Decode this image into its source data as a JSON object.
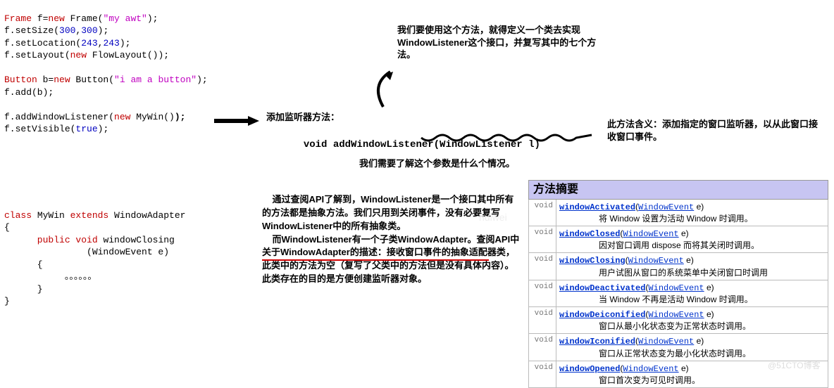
{
  "code": {
    "l1_a": "Frame",
    "l1_b": " f=",
    "l1_c": "new",
    "l1_d": " Frame(",
    "l1_e": "\"my awt\"",
    "l1_f": ");",
    "l2_a": "f.setSize(",
    "l2_b": "300",
    "l2_c": ",",
    "l2_d": "300",
    "l2_e": ");",
    "l3_a": "f.setLocation(",
    "l3_b": "243",
    "l3_c": ",",
    "l3_d": "243",
    "l3_e": ");",
    "l4_a": "f.setLayout(",
    "l4_b": "new",
    "l4_c": " FlowLayout());",
    "l5_a": "Button",
    "l5_b": " b=",
    "l5_c": "new",
    "l5_d": " Button(",
    "l5_e": "\"i am a button\"",
    "l5_f": ");",
    "l6": "f.add(b);",
    "l7_a": "f.addWindowListener(",
    "l7_b": "new",
    "l7_c": " MyWin()",
    "l7_d": ");",
    "l8_a": "f.setVisible(",
    "l8_b": "true",
    "l8_c": ");"
  },
  "code2": {
    "l1_a": "class",
    "l1_b": " MyWin ",
    "l1_c": "extends",
    "l1_d": " WindowAdapter",
    "l2": "{",
    "l3_a": "      public",
    "l3_b": " void",
    "l3_c": " windowClosing",
    "l4": "               (WindowEvent e)",
    "l5": "      {",
    "l6": "           。。。。。。",
    "l7": "      }",
    "l8": "}"
  },
  "notes": {
    "top": "我们要使用这个方法，就得定义一个类去实现WindowListener这个接口，并复写其中的七个方法。",
    "add": "添加监听器方法：",
    "sig_a": "void addWindowListener(",
    "sig_b": "WindowListener l",
    "sig_c": ")",
    "right": "此方法含义：添加指定的窗口监听器，以从此窗口接收窗口事件。",
    "param": "我们需要了解这个参数是什么个情况。",
    "api": "    通过查阅API了解到，WindowListener是一个接口其中所有的方法都是抽象方法。我们只用到关闭事件，没有必要复写WindowListener中的所有抽象类。\n    而WindowListener有一个子类WindowAdapter。查阅API中关于WindowAdapter的描述：接收窗口事件的抽象适配器类，此类中的方法为空（复写了父类中的方法但是没有具体内容）。此类存在的目的是方便创建监听器对象。"
  },
  "table": {
    "header": "方法摘要",
    "ret": "void",
    "paramType": "WindowEvent",
    "paramName": " e",
    "rows": [
      {
        "name": "windowActivated",
        "desc": "将 Window 设置为活动 Window 时调用。"
      },
      {
        "name": "windowClosed",
        "desc": "因对窗口调用 dispose 而将其关闭时调用。"
      },
      {
        "name": "windowClosing",
        "desc": "用户试图从窗口的系统菜单中关闭窗口时调用"
      },
      {
        "name": "windowDeactivated",
        "desc": "当 Window 不再是活动 Window 时调用。"
      },
      {
        "name": "windowDeiconified",
        "desc": "窗口从最小化状态变为正常状态时调用。"
      },
      {
        "name": "windowIconified",
        "desc": "窗口从正常状态变为最小化状态时调用。"
      },
      {
        "name": "windowOpened",
        "desc": "窗口首次变为可见时调用。"
      }
    ]
  },
  "watermark": "@51CTO博客",
  "center_wm": "huiwei"
}
